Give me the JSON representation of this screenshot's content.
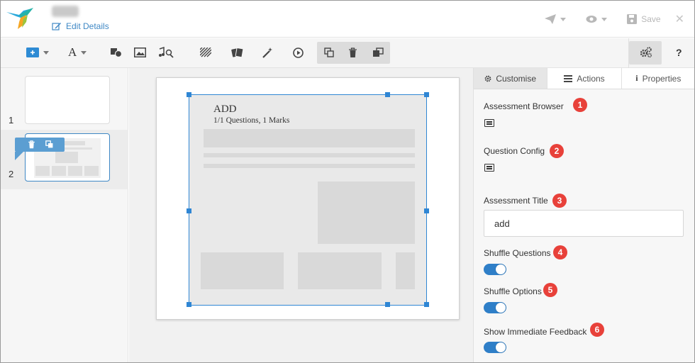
{
  "header": {
    "edit_details_label": "Edit Details",
    "save_label": "Save",
    "icons": [
      "bird-logo-icon",
      "pencil-square-icon",
      "paper-plane-icon",
      "eye-icon",
      "floppy-disk-icon",
      "close-icon"
    ]
  },
  "toolbar": {
    "icons": [
      "add-slide-icon",
      "text-icon",
      "shapes-icon",
      "image-icon",
      "audio-icon",
      "pattern-icon",
      "interactive-icon",
      "magic-wand-icon",
      "play-icon",
      "copy-icon",
      "trash-icon",
      "arrange-icon",
      "gears-icon",
      "help-icon"
    ],
    "help_label": "?"
  },
  "slides": {
    "items": [
      {
        "number": "1"
      },
      {
        "number": "2"
      }
    ]
  },
  "canvas": {
    "question_title": "ADD",
    "question_meta": "1/1  Questions,    1 Marks"
  },
  "panel": {
    "tabs": [
      {
        "label": "Customise",
        "icon": "gear-icon",
        "active": true
      },
      {
        "label": "Actions",
        "icon": "list-icon",
        "active": false
      },
      {
        "label": "Properties",
        "icon": "info-icon",
        "active": false
      }
    ],
    "assessment_browser_label": "Assessment Browser",
    "question_config_label": "Question Config",
    "assessment_title_label": "Assessment Title",
    "assessment_title_value": "add",
    "shuffle_questions_label": "Shuffle Questions",
    "shuffle_questions_on": true,
    "shuffle_options_label": "Shuffle Options",
    "shuffle_options_on": true,
    "immediate_feedback_label": "Show Immediate Feedback",
    "immediate_feedback_on": true,
    "badges": [
      "1",
      "2",
      "3",
      "4",
      "5",
      "6"
    ]
  },
  "colors": {
    "accent": "#2f7fc8",
    "badge": "#e8413a",
    "link": "#3f88c5"
  }
}
